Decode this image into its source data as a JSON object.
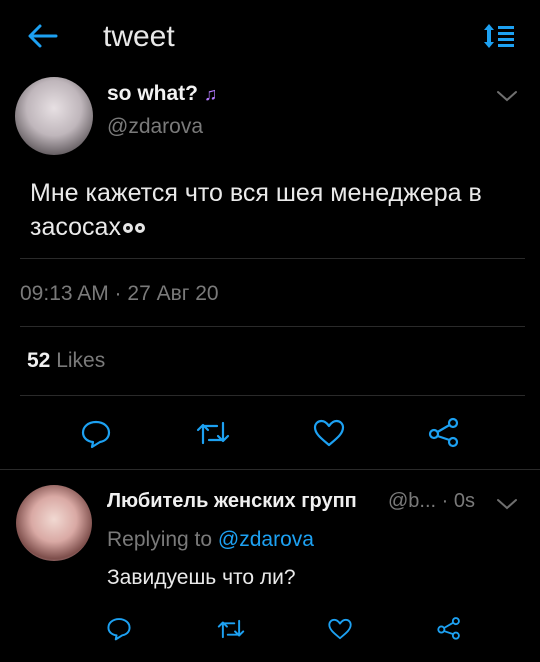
{
  "header": {
    "title": "tweet",
    "back_icon": "back-arrow-icon",
    "sort_icon": "sort-icon",
    "accent": "#1da1f2"
  },
  "tweet": {
    "display_name": "so what?",
    "name_emoji_icon": "music-notes-icon",
    "handle": "@zdarova",
    "text": "Мне кажется что вся шея менеджера в засосах",
    "text_emoji_icon": "eyes-icon",
    "timestamp": "09:13 AM · 27 Авг 20",
    "likes_count": "52",
    "likes_label": "Likes",
    "actions": [
      "reply-icon",
      "retweet-icon",
      "like-icon",
      "share-icon"
    ]
  },
  "reply": {
    "display_name": "Любитель женских групп",
    "handle_time": "@b... · 0s",
    "replying_prefix": "Replying to",
    "replying_to": "@zdarova",
    "text": "Завидуешь что ли?",
    "actions": [
      "reply-icon",
      "retweet-icon",
      "like-icon",
      "share-icon"
    ]
  },
  "colors": {
    "background": "#000000",
    "muted_text": "#7a7a7a",
    "divider": "#2a2a2a",
    "emoji_purple": "#b57bff"
  }
}
